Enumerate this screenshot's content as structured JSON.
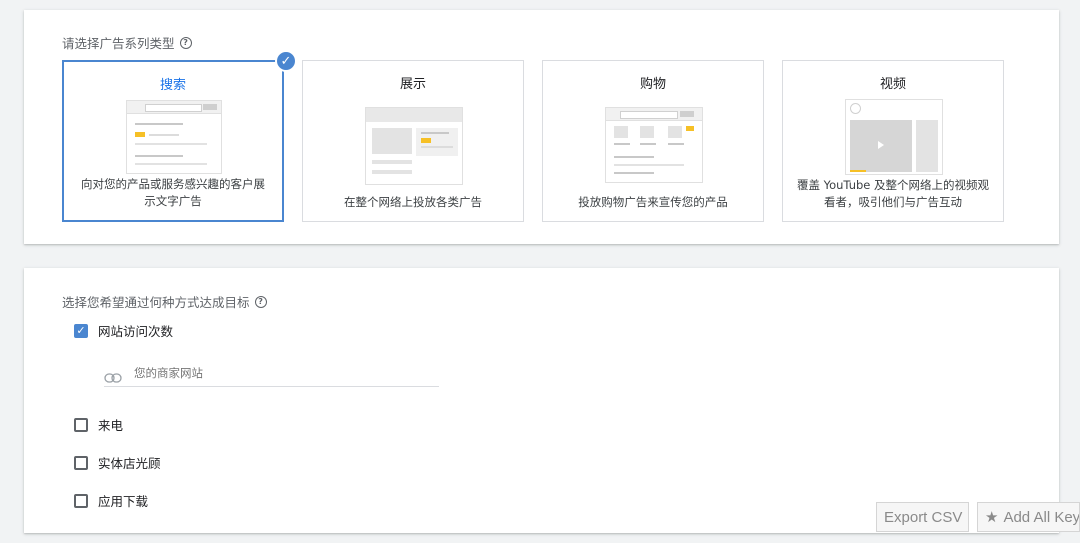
{
  "campaign_type": {
    "title": "请选择广告系列类型",
    "help": "?",
    "selected_mark": "✓",
    "options": [
      {
        "title": "搜索",
        "desc": "向对您的产品或服务感兴趣的客户展示文字广告"
      },
      {
        "title": "展示",
        "desc": "在整个网络上投放各类广告"
      },
      {
        "title": "购物",
        "desc": "投放购物广告来宣传您的产品"
      },
      {
        "title": "视频",
        "desc": "覆盖 YouTube 及整个网络上的视频观看者，吸引他们与广告互动"
      }
    ]
  },
  "goals": {
    "title": "选择您希望通过何种方式达成目标",
    "help": "?",
    "check_mark": "✓",
    "website_visits": {
      "label": "网站访问次数",
      "checked": true,
      "url_placeholder": "您的商家网站"
    },
    "options": [
      {
        "label": "来电",
        "checked": false
      },
      {
        "label": "实体店光顾",
        "checked": false
      },
      {
        "label": "应用下载",
        "checked": false
      }
    ]
  },
  "toolbar": {
    "export_label": "Export CSV",
    "add_all_label": "Add All Keywords",
    "star_glyph": "★"
  },
  "colors": {
    "accent": "#4a86d0",
    "highlight": "#f6c026"
  }
}
